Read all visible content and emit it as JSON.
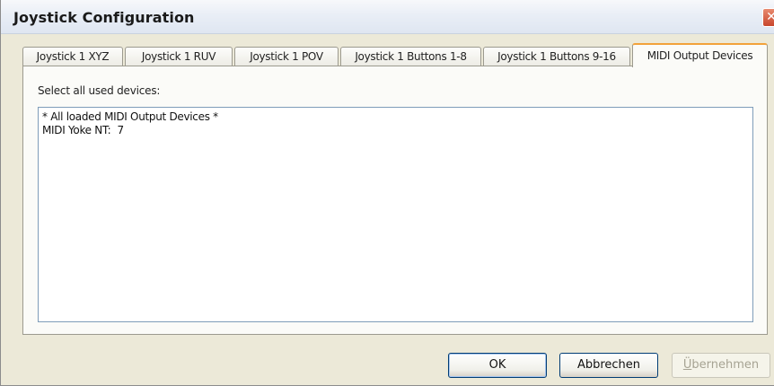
{
  "window": {
    "title": "Joystick Configuration",
    "close_symbol": "✕",
    "accent_color": "#f2a23a"
  },
  "tabs": [
    {
      "label": "Joystick 1 XYZ",
      "active": false
    },
    {
      "label": "Joystick 1 RUV",
      "active": false
    },
    {
      "label": "Joystick 1 POV",
      "active": false
    },
    {
      "label": "Joystick 1 Buttons 1-8",
      "active": false
    },
    {
      "label": "Joystick 1 Buttons 9-16",
      "active": false
    },
    {
      "label": "MIDI Output Devices",
      "active": true
    }
  ],
  "panel": {
    "label": "Select all used devices:",
    "devices": [
      "* All loaded MIDI Output Devices *",
      "MIDI Yoke NT:  7"
    ]
  },
  "buttons": {
    "ok": "OK",
    "cancel": "Abbrechen",
    "apply_mnemonic": "Ü",
    "apply_rest": "bernehmen",
    "apply_enabled": false
  },
  "icons": {
    "close": "close-icon"
  }
}
